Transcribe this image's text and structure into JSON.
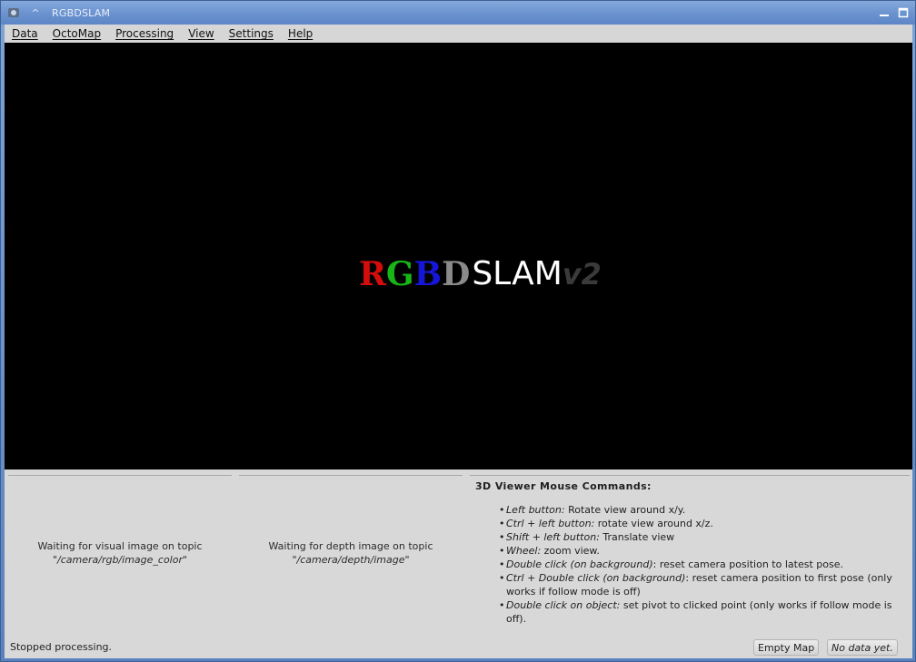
{
  "window": {
    "title": "RGBDSLAM",
    "icons": [
      "app-icon",
      "pin-icon",
      "minimize-icon",
      "maximize-icon"
    ]
  },
  "menubar": {
    "items": [
      {
        "label": "Data",
        "mnemonic": "D",
        "rest": "ata"
      },
      {
        "label": "OctoMap",
        "mnemonic": "O",
        "rest": "ctoMap"
      },
      {
        "label": "Processing",
        "mnemonic": "P",
        "rest": "rocessing"
      },
      {
        "label": "View",
        "mnemonic": "V",
        "rest": "iew"
      },
      {
        "label": "Settings",
        "mnemonic": "S",
        "rest": "ettings"
      },
      {
        "label": "Help",
        "mnemonic": "H",
        "rest": "elp"
      }
    ]
  },
  "viewer": {
    "logo": {
      "r": "R",
      "g": "G",
      "b": "B",
      "d": "D",
      "slam": "SLAM",
      "version": "v2"
    },
    "colors": {
      "r": "#d40c0c",
      "g": "#18b418",
      "b": "#1616d8",
      "d": "#8a8a8a",
      "slam": "#ffffff",
      "version": "#3a3a3a"
    }
  },
  "visual_panel": {
    "waiting": "Waiting for visual image on topic",
    "topic": "\"/camera/rgb/image_color\""
  },
  "depth_panel": {
    "waiting": "Waiting for depth image on topic",
    "topic": "\"/camera/depth/image\""
  },
  "help": {
    "title": "3D Viewer Mouse Commands:",
    "items": [
      {
        "key": "Left button:",
        "desc": " Rotate view around x/y."
      },
      {
        "key": "Ctrl + left button:",
        "desc": " rotate view around x/z."
      },
      {
        "key": "Shift + left button:",
        "desc": " Translate view"
      },
      {
        "key": "Wheel:",
        "desc": " zoom view."
      },
      {
        "key": "Double click (on background)",
        "desc": ": reset camera position to latest pose."
      },
      {
        "key": "Ctrl + Double click (on background)",
        "desc": ": reset camera position to first pose (only works if follow mode is off)"
      },
      {
        "key": "Double click on object:",
        "desc": " set pivot to clicked point (only works if follow mode is off)."
      }
    ]
  },
  "statusbar": {
    "message": "Stopped processing.",
    "map_button": "Empty Map",
    "data_status": "No data yet."
  }
}
